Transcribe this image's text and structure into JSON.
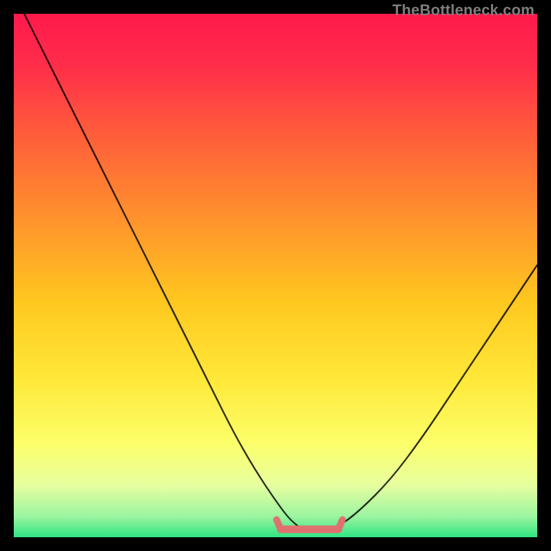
{
  "watermark": "TheBottleneck.com",
  "colors": {
    "black": "#000000",
    "curve": "#000000",
    "marker": "#e07070",
    "gradient_stops": [
      {
        "pos": 0.0,
        "color": "#ff1a4d"
      },
      {
        "pos": 0.1,
        "color": "#ff2e4a"
      },
      {
        "pos": 0.22,
        "color": "#ff5a3c"
      },
      {
        "pos": 0.38,
        "color": "#ff8f2e"
      },
      {
        "pos": 0.55,
        "color": "#ffc81f"
      },
      {
        "pos": 0.7,
        "color": "#ffe93a"
      },
      {
        "pos": 0.82,
        "color": "#fdff6a"
      },
      {
        "pos": 0.9,
        "color": "#e8ffa0"
      },
      {
        "pos": 0.96,
        "color": "#9cf5a0"
      },
      {
        "pos": 1.0,
        "color": "#2fe583"
      }
    ]
  },
  "chart_data": {
    "type": "line",
    "title": "",
    "xlabel": "",
    "ylabel": "",
    "xlim": [
      0,
      100
    ],
    "ylim": [
      0,
      100
    ],
    "legend": false,
    "grid": false,
    "series": [
      {
        "name": "bottleneck-curve",
        "x": [
          2,
          6,
          10,
          14,
          18,
          22,
          26,
          30,
          34,
          38,
          42,
          46,
          50,
          53,
          56,
          59,
          62,
          66,
          72,
          78,
          84,
          90,
          96,
          100
        ],
        "y": [
          100,
          92,
          84,
          76,
          68,
          60,
          52,
          44,
          36,
          28,
          20,
          13,
          7,
          3,
          1,
          1,
          2,
          5,
          11,
          19,
          28,
          37,
          46,
          52
        ]
      }
    ],
    "annotations": [
      {
        "name": "optimal-flat-region",
        "type": "marker-band",
        "x_start": 51,
        "x_end": 62,
        "y": 1.5
      }
    ]
  }
}
